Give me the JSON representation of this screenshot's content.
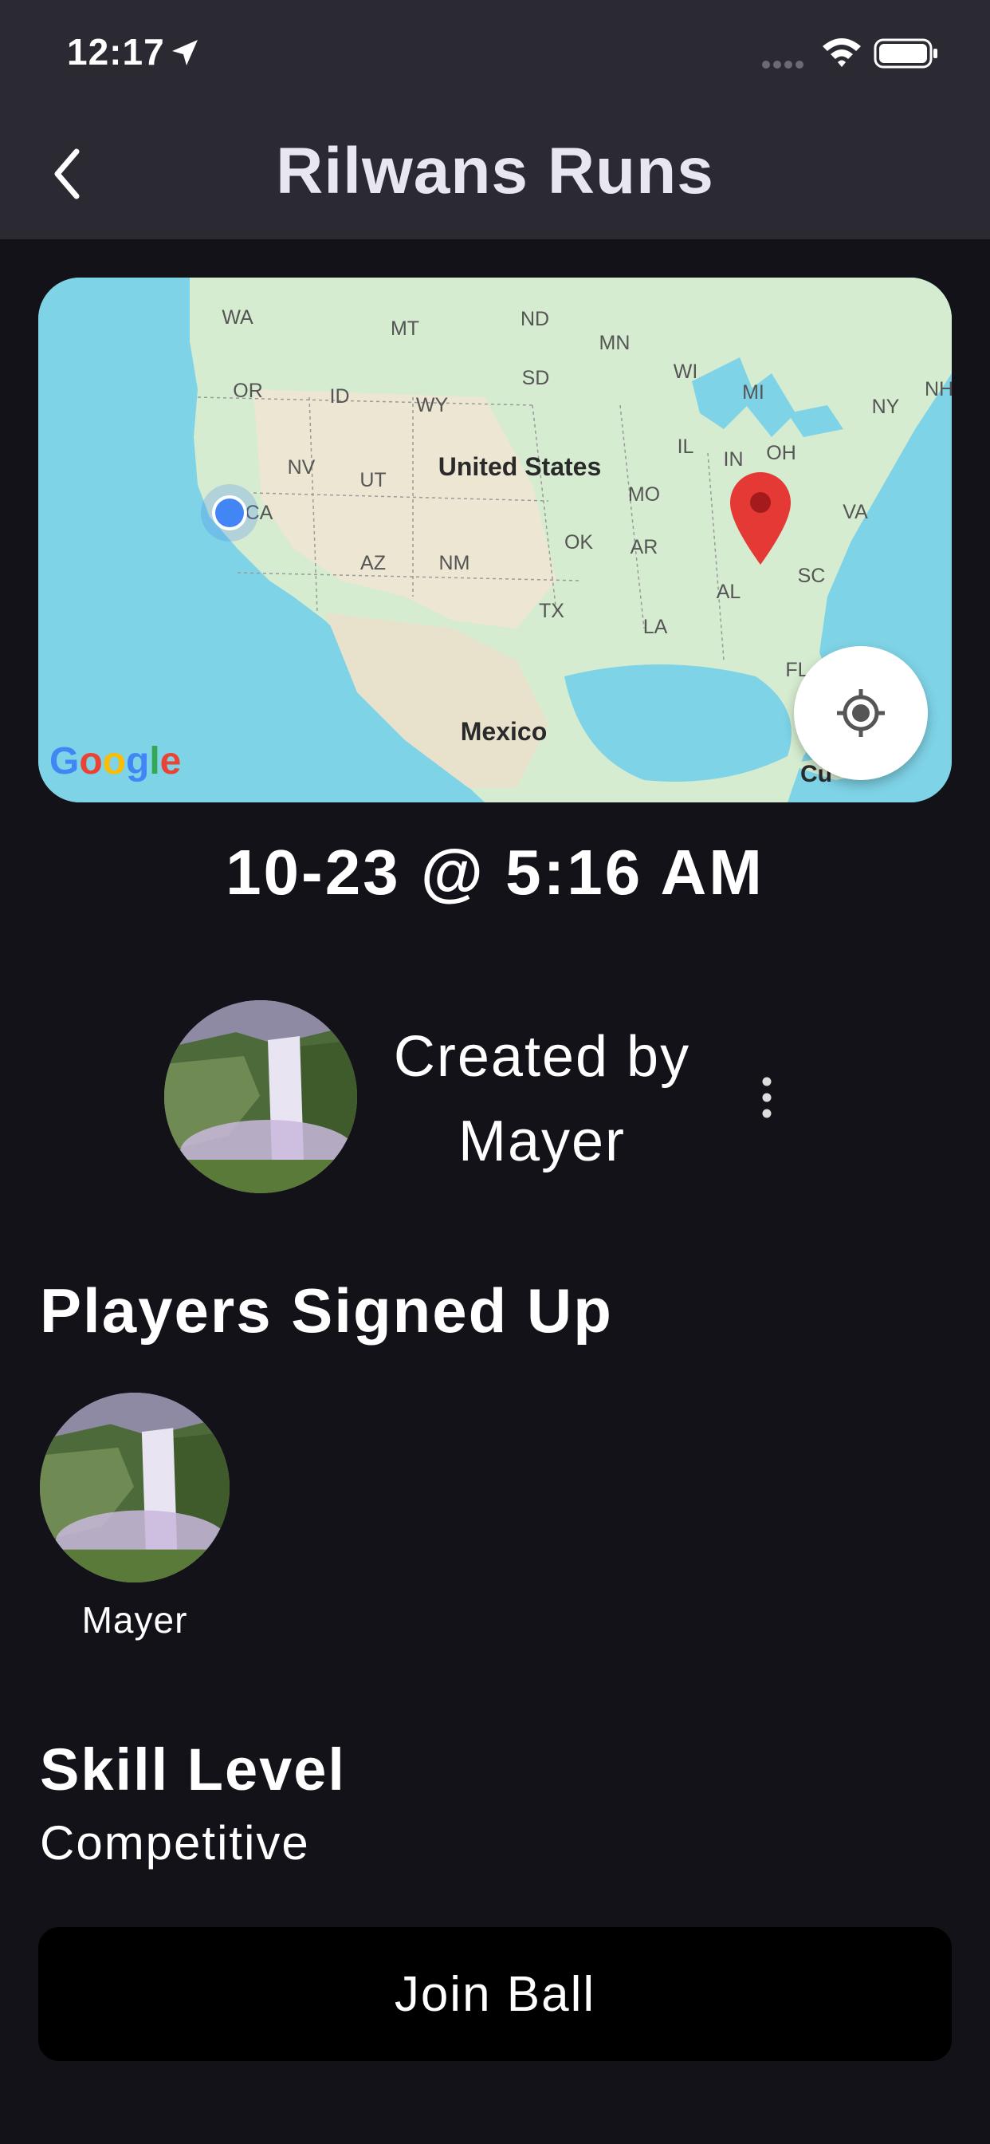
{
  "status_bar": {
    "time": "12:17"
  },
  "nav": {
    "title": "Rilwans Runs",
    "back_icon": "chevron-left-icon"
  },
  "map": {
    "country_label": "United States",
    "mexico_label": "Mexico",
    "cuba_label_partial": "Cu",
    "state_labels": [
      "WA",
      "MT",
      "ND",
      "MN",
      "OR",
      "ID",
      "WY",
      "SD",
      "WI",
      "MI",
      "NY",
      "NH",
      "NV",
      "UT",
      "IL",
      "IN",
      "OH",
      "CA",
      "MO",
      "VA",
      "AZ",
      "NM",
      "OK",
      "AR",
      "SC",
      "TX",
      "AL",
      "LA",
      "FL"
    ],
    "google_logo": "Google",
    "recenter_icon": "my-location-icon",
    "user_location_marker": "blue-dot-icon",
    "pin_marker": "map-pin-icon",
    "colors": {
      "water": "#7ed3e6",
      "land": "#d9eed4",
      "pin": "#e53935",
      "user_dot": "#4285f4"
    }
  },
  "event": {
    "datetime": "10-23 @ 5:16 AM",
    "created_by_label": "Created by",
    "creator_name": "Mayer"
  },
  "players": {
    "heading": "Players Signed Up",
    "list": [
      {
        "name": "Mayer"
      }
    ]
  },
  "skill": {
    "heading": "Skill Level",
    "value": "Competitive"
  },
  "actions": {
    "join_label": "Join Ball"
  }
}
